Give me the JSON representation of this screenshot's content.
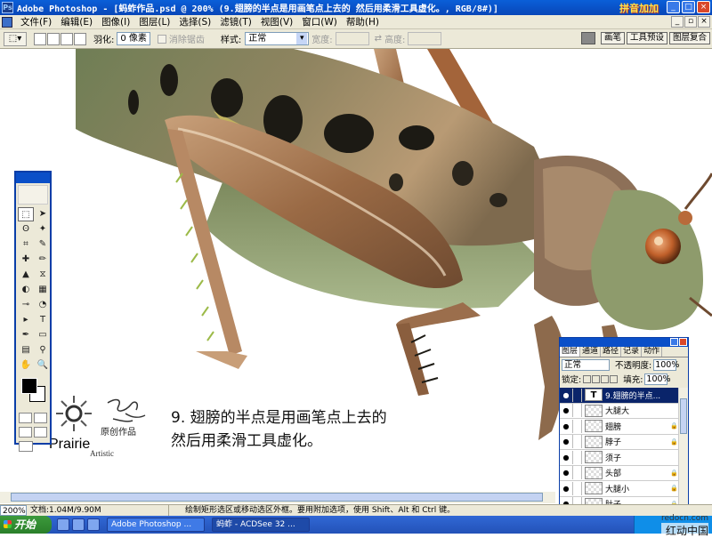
{
  "app": {
    "title": "Adobe Photoshop - [蚂蚱作品.psd @ 200% (9.翅膀的半点是用画笔点上去的 然后用柔滑工具虚化。, RGB/8#)]",
    "ime_label": "拼音加加"
  },
  "menu": [
    "文件(F)",
    "编辑(E)",
    "图像(I)",
    "图层(L)",
    "选择(S)",
    "滤镜(T)",
    "视图(V)",
    "窗口(W)",
    "帮助(H)"
  ],
  "options": {
    "feather_label": "羽化:",
    "feather_value": "0 像素",
    "antialias_label": "消除锯齿",
    "style_label": "样式:",
    "style_value": "正常",
    "width_label": "宽度:",
    "height_label": "高度:"
  },
  "palette_well": [
    "画笔",
    "工具预设",
    "图层复合"
  ],
  "tools": [
    "⬚",
    "➤",
    "ʘ",
    "✦",
    "⌗",
    "✎",
    "✚",
    "✏",
    "▲",
    "⧖",
    "◐",
    "▦",
    "⊸",
    "◔",
    "▸",
    "T",
    "✒",
    "▭",
    "▤",
    "⚲",
    "✋",
    "🔍"
  ],
  "logo": {
    "name": "Prairie",
    "sub": "Artistic",
    "original": "原创作品"
  },
  "caption": {
    "line1": "9. 翅膀的半点是用画笔点上去的",
    "line2": "然后用柔滑工具虚化。"
  },
  "layers_panel": {
    "tabs": [
      "图层",
      "通道",
      "路径",
      "记录",
      "动作"
    ],
    "blend_mode": "正常",
    "opacity_label": "不透明度:",
    "opacity_value": "100%",
    "lock_label": "锁定:",
    "fill_label": "填充:",
    "fill_value": "100%",
    "layers": [
      {
        "name": "9.翅膀的半点...",
        "type": "text",
        "active": true
      },
      {
        "name": "大腿大",
        "type": "raster",
        "locked": false
      },
      {
        "name": "翅膀",
        "type": "raster",
        "locked": true
      },
      {
        "name": "脖子",
        "type": "raster",
        "locked": true
      },
      {
        "name": "须子",
        "type": "raster",
        "locked": false
      },
      {
        "name": "头部",
        "type": "raster",
        "locked": true
      },
      {
        "name": "大腿小",
        "type": "raster",
        "locked": true
      },
      {
        "name": "肚子",
        "type": "raster",
        "locked": true
      }
    ]
  },
  "status": {
    "zoom": "200%",
    "doc": "文档:1.04M/9.90M",
    "message": "绘制矩形选区或移动选区外框。要用附加选项，使用 Shift、Alt 和 Ctrl 键。"
  },
  "taskbar": {
    "start": "开始",
    "tasks": [
      "Adobe Photoshop ...",
      "蚂蚱 - ACDSee 32 ..."
    ]
  },
  "watermark": {
    "url": "redocn.com",
    "name": "红动中国"
  },
  "colors": {
    "title_bar": "#0a5fd8",
    "chrome": "#ece9d8",
    "foreground": "#000000",
    "background": "#ffffff"
  }
}
